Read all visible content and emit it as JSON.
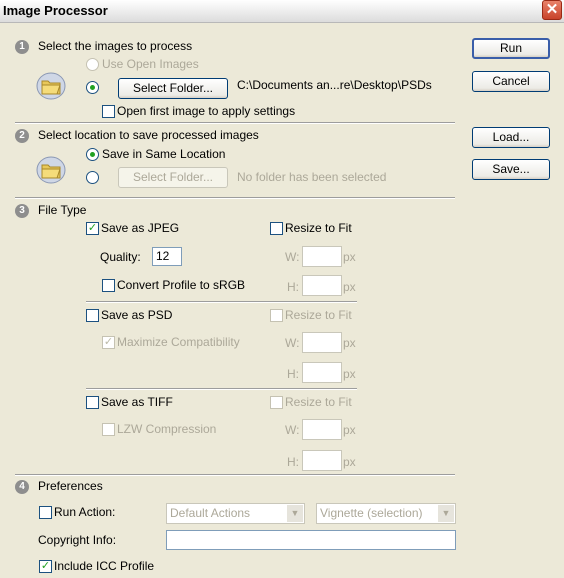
{
  "window": {
    "title": "Image Processor",
    "close_glyph": "✕"
  },
  "section1": {
    "num": "1",
    "title": "Select the images to process",
    "use_open_images": "Use Open Images",
    "select_folder": "Select Folder...",
    "folder_path": "C:\\Documents an...re\\Desktop\\PSDs",
    "open_first": "Open first image to apply settings"
  },
  "section2": {
    "num": "2",
    "title": "Select location to save processed images",
    "save_same": "Save in Same Location",
    "select_folder": "Select Folder...",
    "no_folder": "No folder has been selected"
  },
  "section3": {
    "num": "3",
    "title": "File Type",
    "jpeg": {
      "label": "Save as JPEG",
      "resize": "Resize to Fit",
      "quality_label": "Quality:",
      "quality_value": "12",
      "convert": "Convert Profile to sRGB"
    },
    "psd": {
      "label": "Save as PSD",
      "resize": "Resize to Fit",
      "maximize": "Maximize Compatibility"
    },
    "tiff": {
      "label": "Save as TIFF",
      "resize": "Resize to Fit",
      "lzw": "LZW Compression"
    },
    "w_label": "W:",
    "h_label": "H:",
    "px": "px"
  },
  "section4": {
    "num": "4",
    "title": "Preferences",
    "run_action": "Run Action:",
    "action_set": "Default Actions",
    "action": "Vignette (selection)",
    "copyright": "Copyright Info:",
    "icc": "Include ICC Profile"
  },
  "buttons": {
    "run": "Run",
    "cancel": "Cancel",
    "load": "Load...",
    "save": "Save..."
  },
  "glyphs": {
    "check": "✓",
    "arrow": "▼"
  }
}
